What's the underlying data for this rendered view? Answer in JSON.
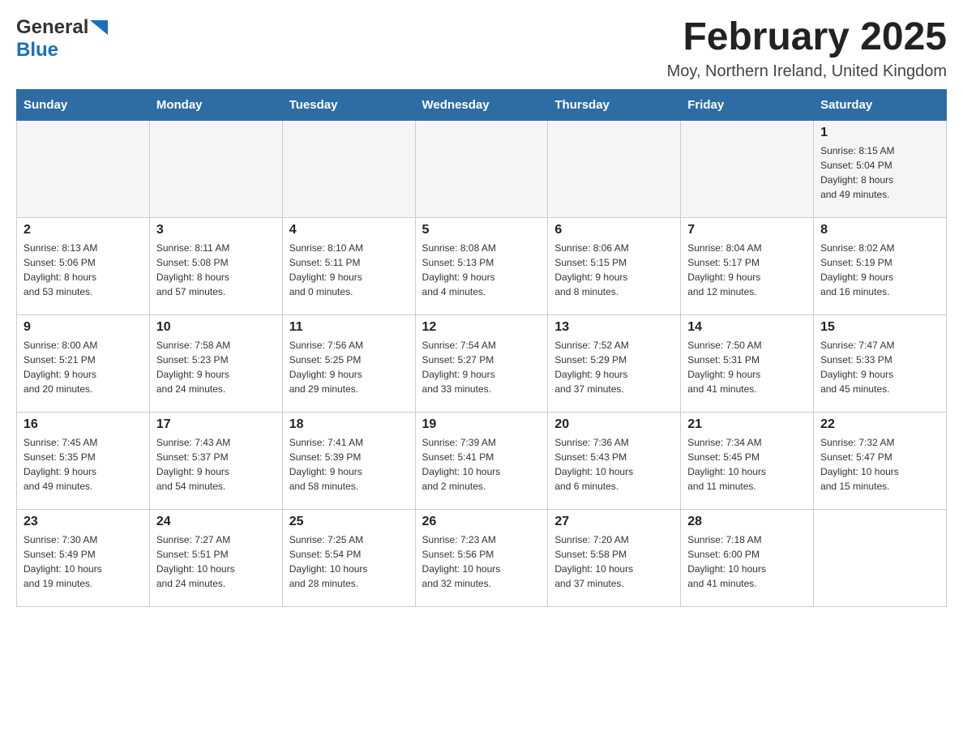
{
  "header": {
    "logo_general": "General",
    "logo_blue": "Blue",
    "month_title": "February 2025",
    "location": "Moy, Northern Ireland, United Kingdom"
  },
  "weekdays": [
    "Sunday",
    "Monday",
    "Tuesday",
    "Wednesday",
    "Thursday",
    "Friday",
    "Saturday"
  ],
  "weeks": [
    [
      {
        "day": "",
        "info": ""
      },
      {
        "day": "",
        "info": ""
      },
      {
        "day": "",
        "info": ""
      },
      {
        "day": "",
        "info": ""
      },
      {
        "day": "",
        "info": ""
      },
      {
        "day": "",
        "info": ""
      },
      {
        "day": "1",
        "info": "Sunrise: 8:15 AM\nSunset: 5:04 PM\nDaylight: 8 hours\nand 49 minutes."
      }
    ],
    [
      {
        "day": "2",
        "info": "Sunrise: 8:13 AM\nSunset: 5:06 PM\nDaylight: 8 hours\nand 53 minutes."
      },
      {
        "day": "3",
        "info": "Sunrise: 8:11 AM\nSunset: 5:08 PM\nDaylight: 8 hours\nand 57 minutes."
      },
      {
        "day": "4",
        "info": "Sunrise: 8:10 AM\nSunset: 5:11 PM\nDaylight: 9 hours\nand 0 minutes."
      },
      {
        "day": "5",
        "info": "Sunrise: 8:08 AM\nSunset: 5:13 PM\nDaylight: 9 hours\nand 4 minutes."
      },
      {
        "day": "6",
        "info": "Sunrise: 8:06 AM\nSunset: 5:15 PM\nDaylight: 9 hours\nand 8 minutes."
      },
      {
        "day": "7",
        "info": "Sunrise: 8:04 AM\nSunset: 5:17 PM\nDaylight: 9 hours\nand 12 minutes."
      },
      {
        "day": "8",
        "info": "Sunrise: 8:02 AM\nSunset: 5:19 PM\nDaylight: 9 hours\nand 16 minutes."
      }
    ],
    [
      {
        "day": "9",
        "info": "Sunrise: 8:00 AM\nSunset: 5:21 PM\nDaylight: 9 hours\nand 20 minutes."
      },
      {
        "day": "10",
        "info": "Sunrise: 7:58 AM\nSunset: 5:23 PM\nDaylight: 9 hours\nand 24 minutes."
      },
      {
        "day": "11",
        "info": "Sunrise: 7:56 AM\nSunset: 5:25 PM\nDaylight: 9 hours\nand 29 minutes."
      },
      {
        "day": "12",
        "info": "Sunrise: 7:54 AM\nSunset: 5:27 PM\nDaylight: 9 hours\nand 33 minutes."
      },
      {
        "day": "13",
        "info": "Sunrise: 7:52 AM\nSunset: 5:29 PM\nDaylight: 9 hours\nand 37 minutes."
      },
      {
        "day": "14",
        "info": "Sunrise: 7:50 AM\nSunset: 5:31 PM\nDaylight: 9 hours\nand 41 minutes."
      },
      {
        "day": "15",
        "info": "Sunrise: 7:47 AM\nSunset: 5:33 PM\nDaylight: 9 hours\nand 45 minutes."
      }
    ],
    [
      {
        "day": "16",
        "info": "Sunrise: 7:45 AM\nSunset: 5:35 PM\nDaylight: 9 hours\nand 49 minutes."
      },
      {
        "day": "17",
        "info": "Sunrise: 7:43 AM\nSunset: 5:37 PM\nDaylight: 9 hours\nand 54 minutes."
      },
      {
        "day": "18",
        "info": "Sunrise: 7:41 AM\nSunset: 5:39 PM\nDaylight: 9 hours\nand 58 minutes."
      },
      {
        "day": "19",
        "info": "Sunrise: 7:39 AM\nSunset: 5:41 PM\nDaylight: 10 hours\nand 2 minutes."
      },
      {
        "day": "20",
        "info": "Sunrise: 7:36 AM\nSunset: 5:43 PM\nDaylight: 10 hours\nand 6 minutes."
      },
      {
        "day": "21",
        "info": "Sunrise: 7:34 AM\nSunset: 5:45 PM\nDaylight: 10 hours\nand 11 minutes."
      },
      {
        "day": "22",
        "info": "Sunrise: 7:32 AM\nSunset: 5:47 PM\nDaylight: 10 hours\nand 15 minutes."
      }
    ],
    [
      {
        "day": "23",
        "info": "Sunrise: 7:30 AM\nSunset: 5:49 PM\nDaylight: 10 hours\nand 19 minutes."
      },
      {
        "day": "24",
        "info": "Sunrise: 7:27 AM\nSunset: 5:51 PM\nDaylight: 10 hours\nand 24 minutes."
      },
      {
        "day": "25",
        "info": "Sunrise: 7:25 AM\nSunset: 5:54 PM\nDaylight: 10 hours\nand 28 minutes."
      },
      {
        "day": "26",
        "info": "Sunrise: 7:23 AM\nSunset: 5:56 PM\nDaylight: 10 hours\nand 32 minutes."
      },
      {
        "day": "27",
        "info": "Sunrise: 7:20 AM\nSunset: 5:58 PM\nDaylight: 10 hours\nand 37 minutes."
      },
      {
        "day": "28",
        "info": "Sunrise: 7:18 AM\nSunset: 6:00 PM\nDaylight: 10 hours\nand 41 minutes."
      },
      {
        "day": "",
        "info": ""
      }
    ]
  ]
}
